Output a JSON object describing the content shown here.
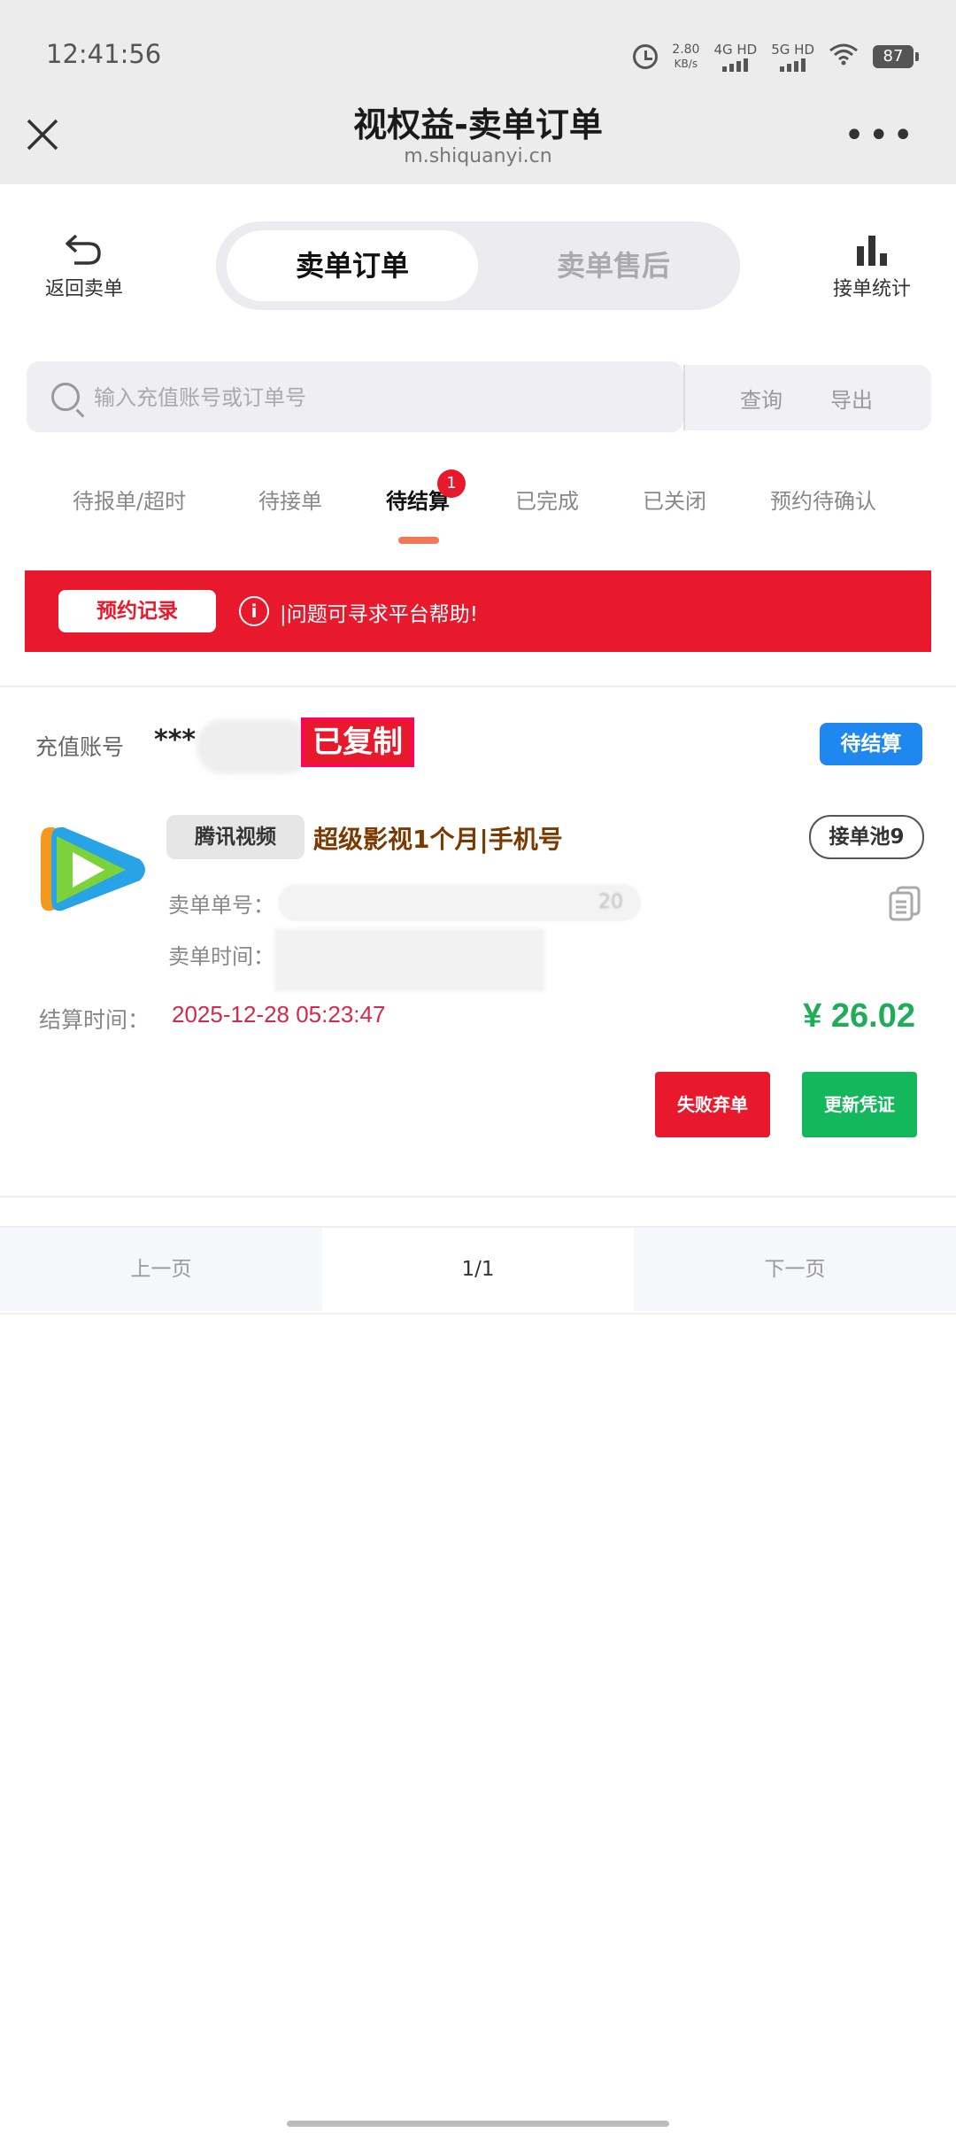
{
  "status_bar": {
    "time": "12:41:56",
    "net_speed_value": "2.80",
    "net_speed_unit": "KB/s",
    "signal1": "4G HD",
    "signal2": "5G HD",
    "battery": "87"
  },
  "browser": {
    "title": "视权益-卖单订单",
    "url": "m.shiquanyi.cn"
  },
  "nav": {
    "back_label": "返回卖单",
    "tab_active": "卖单订单",
    "tab_inactive": "卖单售后",
    "stats_label": "接单统计"
  },
  "search": {
    "placeholder": "输入充值账号或订单号",
    "query_label": "查询",
    "export_label": "导出"
  },
  "status_tabs": [
    {
      "label": "待报单/超时"
    },
    {
      "label": "待接单"
    },
    {
      "label": "待结算",
      "badge": "1"
    },
    {
      "label": "已完成"
    },
    {
      "label": "已关闭"
    },
    {
      "label": "预约待确认"
    }
  ],
  "banner": {
    "reserve_label": "预约记录",
    "message": "|问题可寻求平台帮助!"
  },
  "order": {
    "account_label": "充值账号",
    "account_value": "***",
    "copied_label": "已复制",
    "status": "待结算",
    "platform": "腾讯视频",
    "product": "超级影视1个月|手机号",
    "pool": "接单池9",
    "order_no_label": "卖单单号：",
    "order_no_tail": "20",
    "order_time_label": "卖单时间：",
    "settle_label": "结算时间：",
    "settle_time": "2025-12-28 05:23:47",
    "price": "¥ 26.02",
    "fail_btn": "失败弃单",
    "renew_btn": "更新凭证"
  },
  "pagination": {
    "prev": "上一页",
    "page": "1/1",
    "next": "下一页"
  },
  "colors": {
    "accent_red": "#e8192c",
    "accent_green": "#12b85b",
    "accent_blue": "#1e88f0"
  }
}
